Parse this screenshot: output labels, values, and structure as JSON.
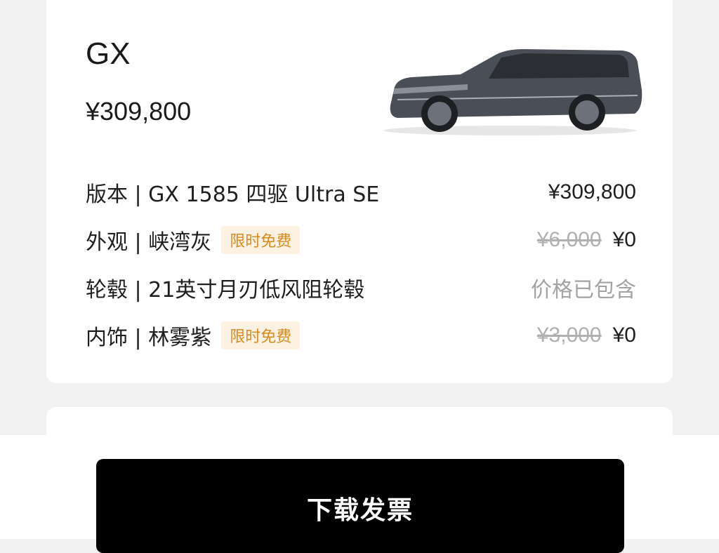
{
  "vehicle": {
    "model": "GX",
    "price": "¥309,800",
    "image": "car-side-view-image"
  },
  "config_rows": [
    {
      "label": "版本 | GX 1585 四驱 Ultra SE",
      "tag": "",
      "original_price": "",
      "price": "¥309,800"
    },
    {
      "label": "外观 | 峡湾灰",
      "tag": "限时免费",
      "original_price": "¥6,000",
      "price": "¥0"
    },
    {
      "label": "轮毂 | 21英寸月刃低风阻轮毂",
      "tag": "",
      "original_price": "",
      "price": "价格已包含"
    },
    {
      "label": "内饰 | 林雾紫",
      "tag": "限时免费",
      "original_price": "¥3,000",
      "price": "¥0"
    }
  ],
  "actions": {
    "download_invoice": "下载发票"
  },
  "colors": {
    "tag_bg": "#fdf2e2",
    "tag_text": "#d98b1f",
    "button_bg": "#000000",
    "page_bg": "#f2f2f2"
  }
}
